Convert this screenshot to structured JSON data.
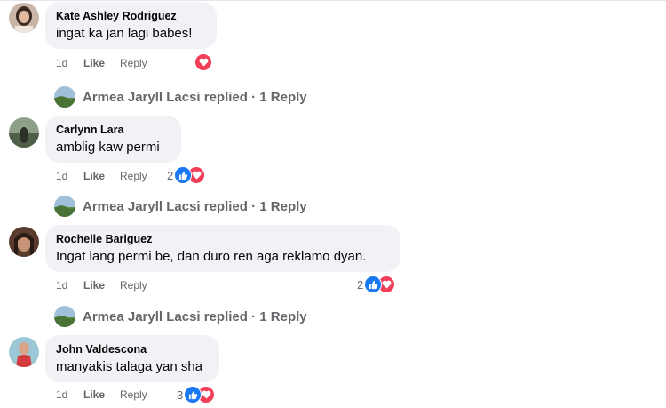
{
  "comments": [
    {
      "author": "Kate Ashley Rodriguez",
      "text": "ingat ka jan lagi babes!",
      "time": "1d",
      "like_label": "Like",
      "reply_label": "Reply",
      "reaction_count": "",
      "reactions": [
        "love"
      ],
      "replies_text": "Armea Jaryll Lacsi replied · 1 Reply"
    },
    {
      "author": "Carlynn Lara",
      "text": "amblig kaw permi",
      "time": "1d",
      "like_label": "Like",
      "reply_label": "Reply",
      "reaction_count": "2",
      "reactions": [
        "like",
        "love"
      ],
      "replies_text": "Armea Jaryll Lacsi replied · 1 Reply"
    },
    {
      "author": "Rochelle Bariguez",
      "text": "Ingat lang permi be, dan duro ren aga reklamo dyan.",
      "time": "1d",
      "like_label": "Like",
      "reply_label": "Reply",
      "reaction_count": "2",
      "reactions": [
        "like",
        "love"
      ],
      "replies_text": "Armea Jaryll Lacsi replied · 1 Reply"
    },
    {
      "author": "John Valdescona",
      "text": "manyakis talaga yan sha",
      "time": "1d",
      "like_label": "Like",
      "reply_label": "Reply",
      "reaction_count": "3",
      "reactions": [
        "like",
        "love"
      ],
      "replies_text": ""
    }
  ],
  "colors": {
    "bubble": "#f0f2f5",
    "like": "#1877f2",
    "love": "#f33e58",
    "meta": "#65676b"
  }
}
